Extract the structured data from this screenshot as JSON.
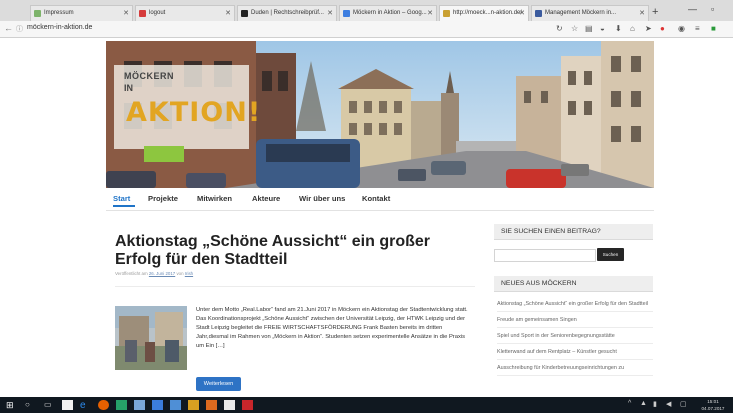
{
  "browser": {
    "tabs": [
      {
        "label": "Impressum",
        "active": false
      },
      {
        "label": "logout",
        "active": false
      },
      {
        "label": "Duden | Rechtschreibprüf...",
        "active": false
      },
      {
        "label": "Möckern in Aktion – Goog...",
        "active": false
      },
      {
        "label": "http://moeck...n-aktion.de/",
        "active": true
      },
      {
        "label": "Management Möckern in...",
        "active": false
      }
    ],
    "url": "möckern-in-aktion.de"
  },
  "site": {
    "logo_line1": "MÖCKERN",
    "logo_line2": "IN",
    "logo_word": "AKTION!",
    "nav": [
      "Start",
      "Projekte",
      "Mitwirken",
      "Akteure",
      "Wir über uns",
      "Kontakt"
    ],
    "active_nav": "Start"
  },
  "post": {
    "title": "Aktionstag „Schöne Aussicht“ ein großer Erfolg für den Stadtteil",
    "meta_prefix": "Veröffentlicht am",
    "meta_date": "26. Juni 2017",
    "meta_by": "von",
    "meta_author": "Irish",
    "excerpt": "Unter dem Motto „Real.Labor“ fand am 21.Juni 2017 in Möckern ein Aktionstag der Stadtentwicklung statt. Das Koordinationsprojekt „Schöne Aussicht“ zwischen der Universität Leipzig, der HTWK Leipzig und der Stadt Leipzig begleitet die FREIE WIRTSCHAFTSFÖRDERUNG Frank Basten bereits im dritten Jahr,diesmal im Rahmen von „Möckern in Aktion“. Studenten setzen experimentelle Ansätze in die Praxis um Ein […]",
    "read_more": "Weiterlesen"
  },
  "sidebar": {
    "search_title": "SIE SUCHEN EINEN BEITRAG?",
    "search_button": "Suchen",
    "news_title": "NEUES AUS MÖCKERN",
    "news": [
      "Aktionstag „Schöne Aussicht“ ein großer Erfolg für den Stadtteil",
      "Freude am gemeinsamen Singen",
      "Spiel und Sport in der Seniorenbegegnungsstätte",
      "Kletterwand auf dem Rentplatz – Künstler gesucht",
      "Ausschreibung für Kinderbetreuungseinrichtungen zu"
    ]
  },
  "taskbar": {
    "time": "15:01",
    "date": "04.07.2017"
  }
}
